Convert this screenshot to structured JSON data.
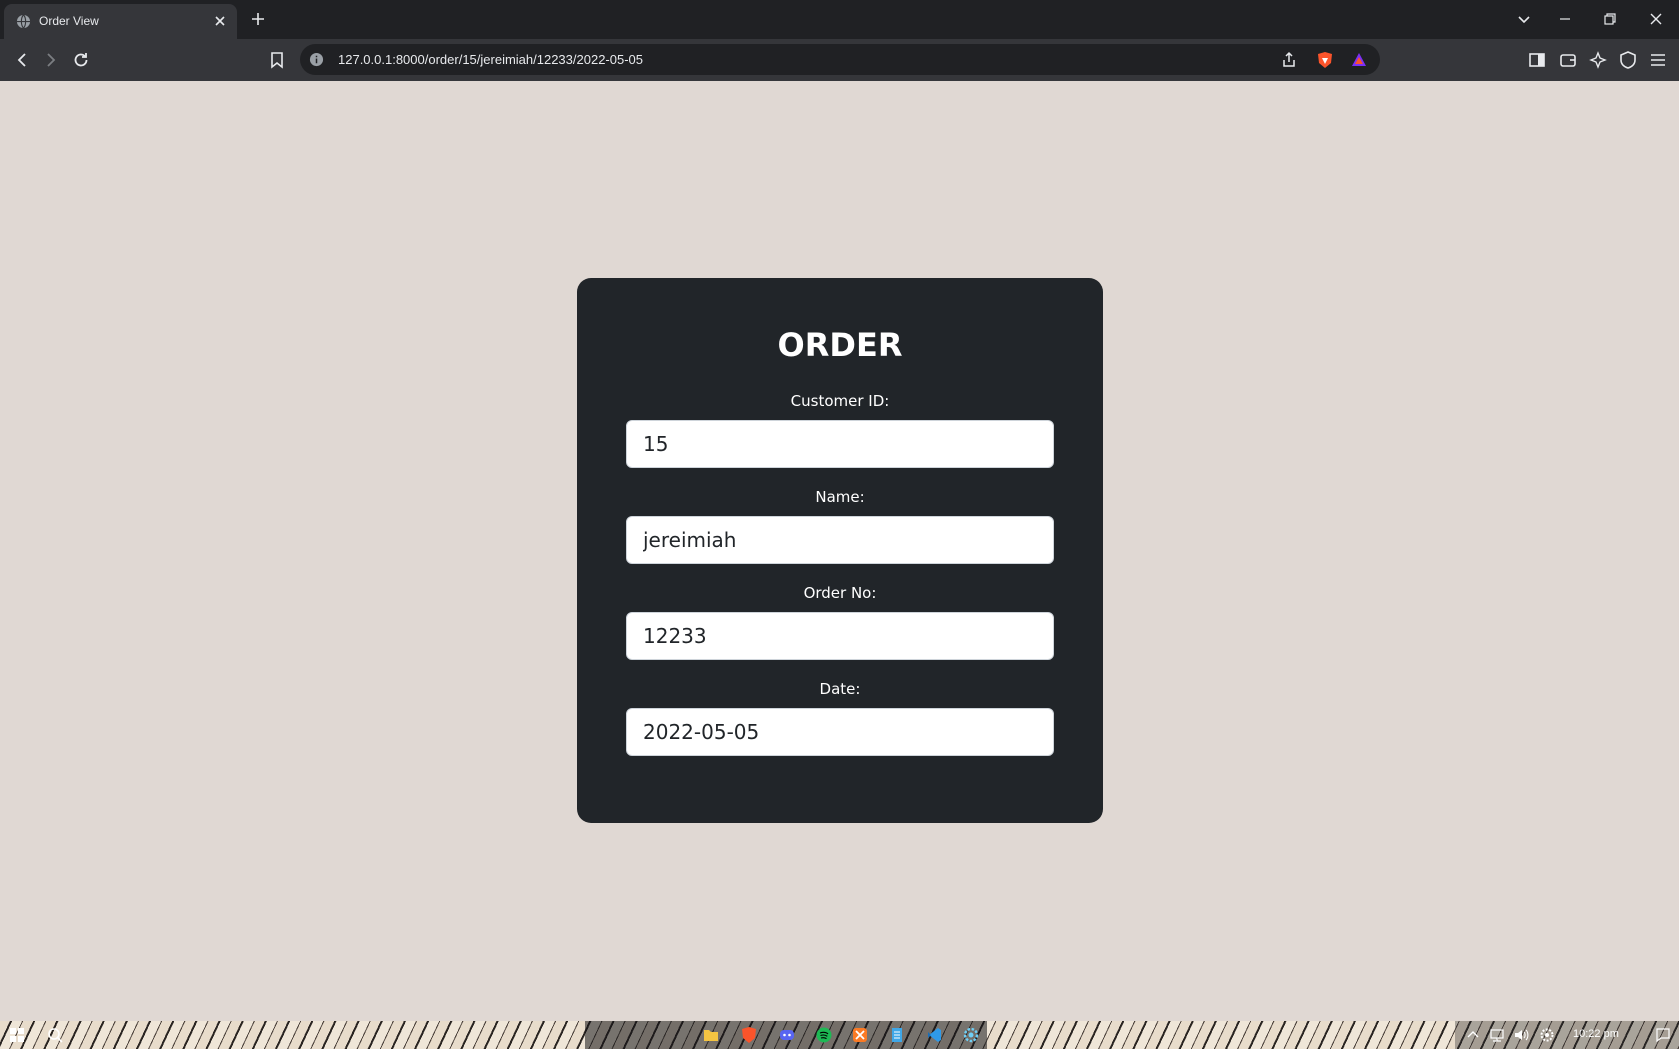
{
  "browser": {
    "tab_title": "Order View",
    "url": "127.0.0.1:8000/order/15/jereimiah/12233/2022-05-05"
  },
  "page": {
    "title": "ORDER",
    "fields": [
      {
        "label": "Customer ID:",
        "value": "15"
      },
      {
        "label": "Name:",
        "value": "jereimiah"
      },
      {
        "label": "Order No:",
        "value": "12233"
      },
      {
        "label": "Date:",
        "value": "2022-05-05"
      }
    ]
  },
  "taskbar": {
    "clock": "10:22 pm"
  },
  "colors": {
    "page_background": "#e0d8d3",
    "card_background": "#212529",
    "browser_dark": "#202124",
    "browser_toolbar": "#35363a",
    "brave_orange": "#fb542b"
  },
  "icons": [
    "globe-icon",
    "close-icon",
    "plus-icon",
    "chevron-down-icon",
    "minimize-icon",
    "restore-icon",
    "back-icon",
    "forward-icon",
    "reload-icon",
    "bookmark-icon",
    "info-icon",
    "share-icon",
    "brave-shield-icon",
    "brave-rewards-icon",
    "sidebar-icon",
    "wallet-icon",
    "leo-icon",
    "vpn-icon",
    "menu-icon",
    "windows-start-icon",
    "search-icon",
    "folder-icon",
    "brave-icon",
    "discord-icon",
    "spotify-icon",
    "xampp-icon",
    "notepad-icon",
    "vscode-icon",
    "settings-icon",
    "network-icon",
    "volume-icon",
    "notification-icon"
  ]
}
